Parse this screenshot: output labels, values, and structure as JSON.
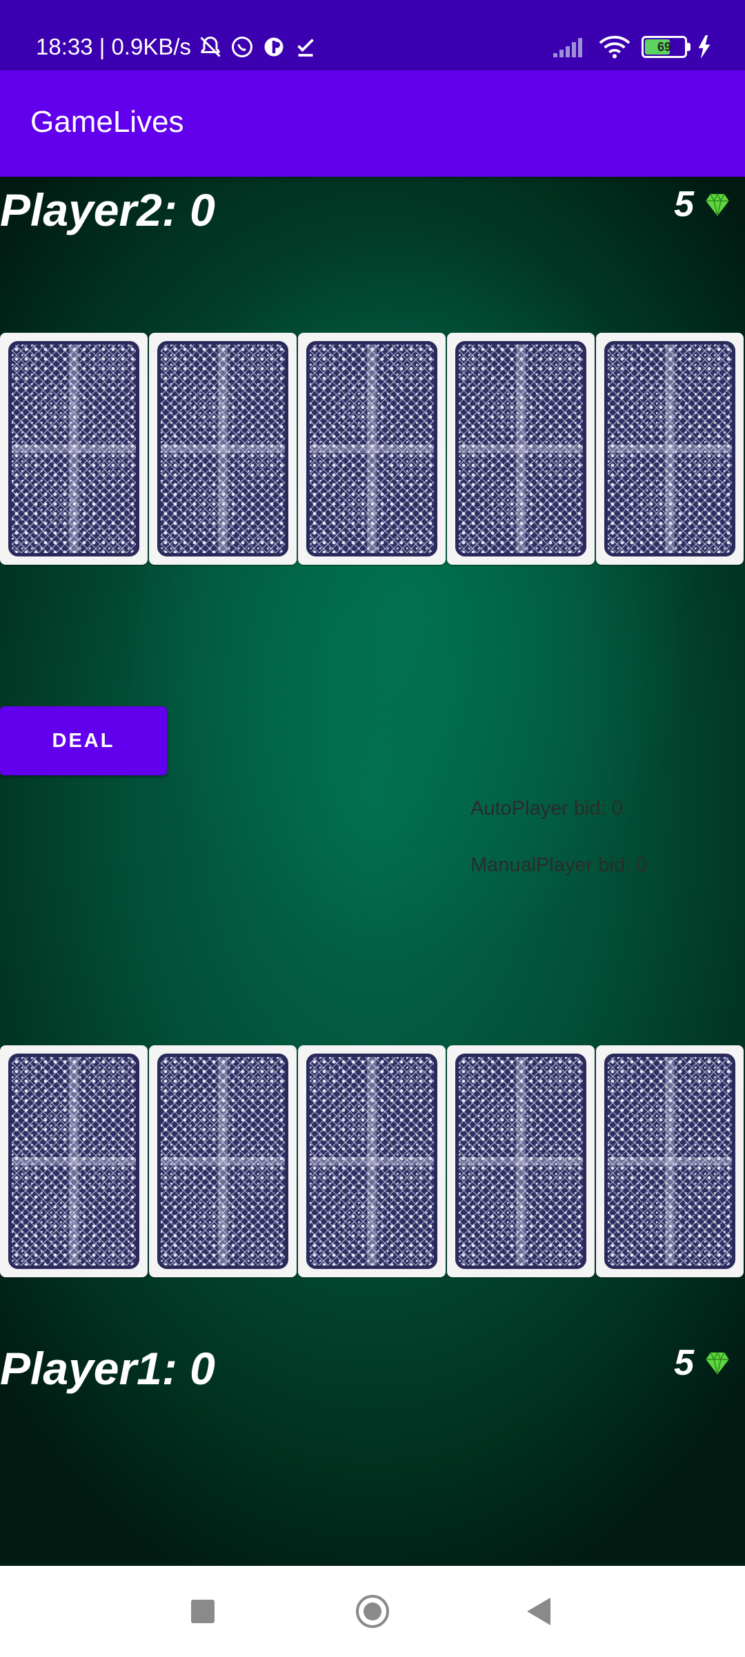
{
  "status_bar": {
    "time_speed": "18:33 | 0.9KB/s",
    "battery_level": "69",
    "icons": [
      "bell-off-icon",
      "whatsapp-icon",
      "vpn-icon",
      "download-done-icon",
      "signal-icon",
      "wifi-icon",
      "battery-icon",
      "charging-icon"
    ]
  },
  "app_bar": {
    "title": "GameLives"
  },
  "game": {
    "player2": {
      "label": "Player2: 0",
      "lives": "5"
    },
    "player1": {
      "label": "Player1: 0",
      "lives": "5"
    },
    "deal_button": "DEAL",
    "auto_bid": "AutoPlayer bid: 0",
    "manual_bid": "ManualPlayer bid: 0",
    "cards_per_row": 5,
    "table_color": "#025038",
    "accent_color": "#6200ee"
  },
  "nav_bar": {
    "icons": [
      "recents-icon",
      "home-icon",
      "back-icon"
    ]
  }
}
